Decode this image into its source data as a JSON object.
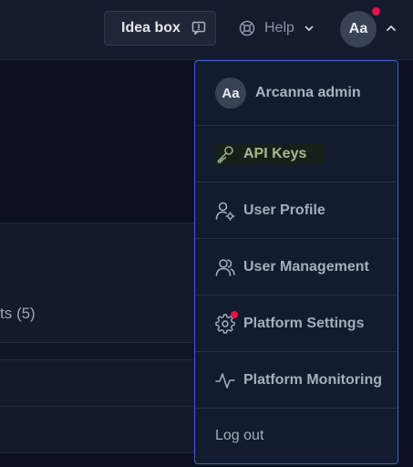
{
  "topbar": {
    "idea_box_label": "Idea box",
    "help_label": "Help",
    "avatar_initials": "Aa"
  },
  "background": {
    "partial_text": "ts (5)"
  },
  "menu": {
    "user": {
      "initials": "Aa",
      "name": "Arcanna admin"
    },
    "items": [
      {
        "label": "API Keys",
        "icon": "key-icon"
      },
      {
        "label": "User Profile",
        "icon": "user-gear-icon"
      },
      {
        "label": "User Management",
        "icon": "users-icon"
      },
      {
        "label": "Platform Settings",
        "icon": "gear-icon"
      },
      {
        "label": "Platform Monitoring",
        "icon": "activity-icon"
      }
    ],
    "logout_label": "Log out"
  },
  "colors": {
    "accent_border": "#3565c7",
    "notification": "#e1144a",
    "highlight_text": "#a5b88a"
  }
}
